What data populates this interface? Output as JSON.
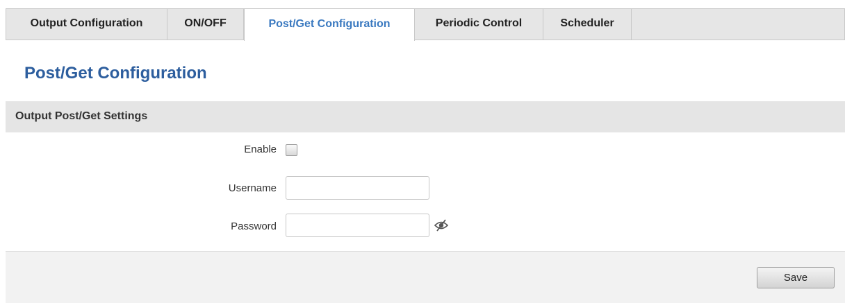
{
  "tabs": [
    {
      "label": "Output Configuration",
      "active": false
    },
    {
      "label": "ON/OFF",
      "active": false
    },
    {
      "label": "Post/Get Configuration",
      "active": true
    },
    {
      "label": "Periodic Control",
      "active": false
    },
    {
      "label": "Scheduler",
      "active": false
    }
  ],
  "page": {
    "title": "Post/Get Configuration"
  },
  "section": {
    "title": "Output Post/Get Settings"
  },
  "form": {
    "enable": {
      "label": "Enable",
      "checked": false
    },
    "username": {
      "label": "Username",
      "value": ""
    },
    "password": {
      "label": "Password",
      "value": "",
      "toggle_icon": "eye-slash-icon"
    }
  },
  "footer": {
    "save_label": "Save"
  },
  "colors": {
    "accent": "#2d5e9e",
    "active_tab_text": "#3a79c0",
    "header_bg": "#e5e5e5"
  }
}
